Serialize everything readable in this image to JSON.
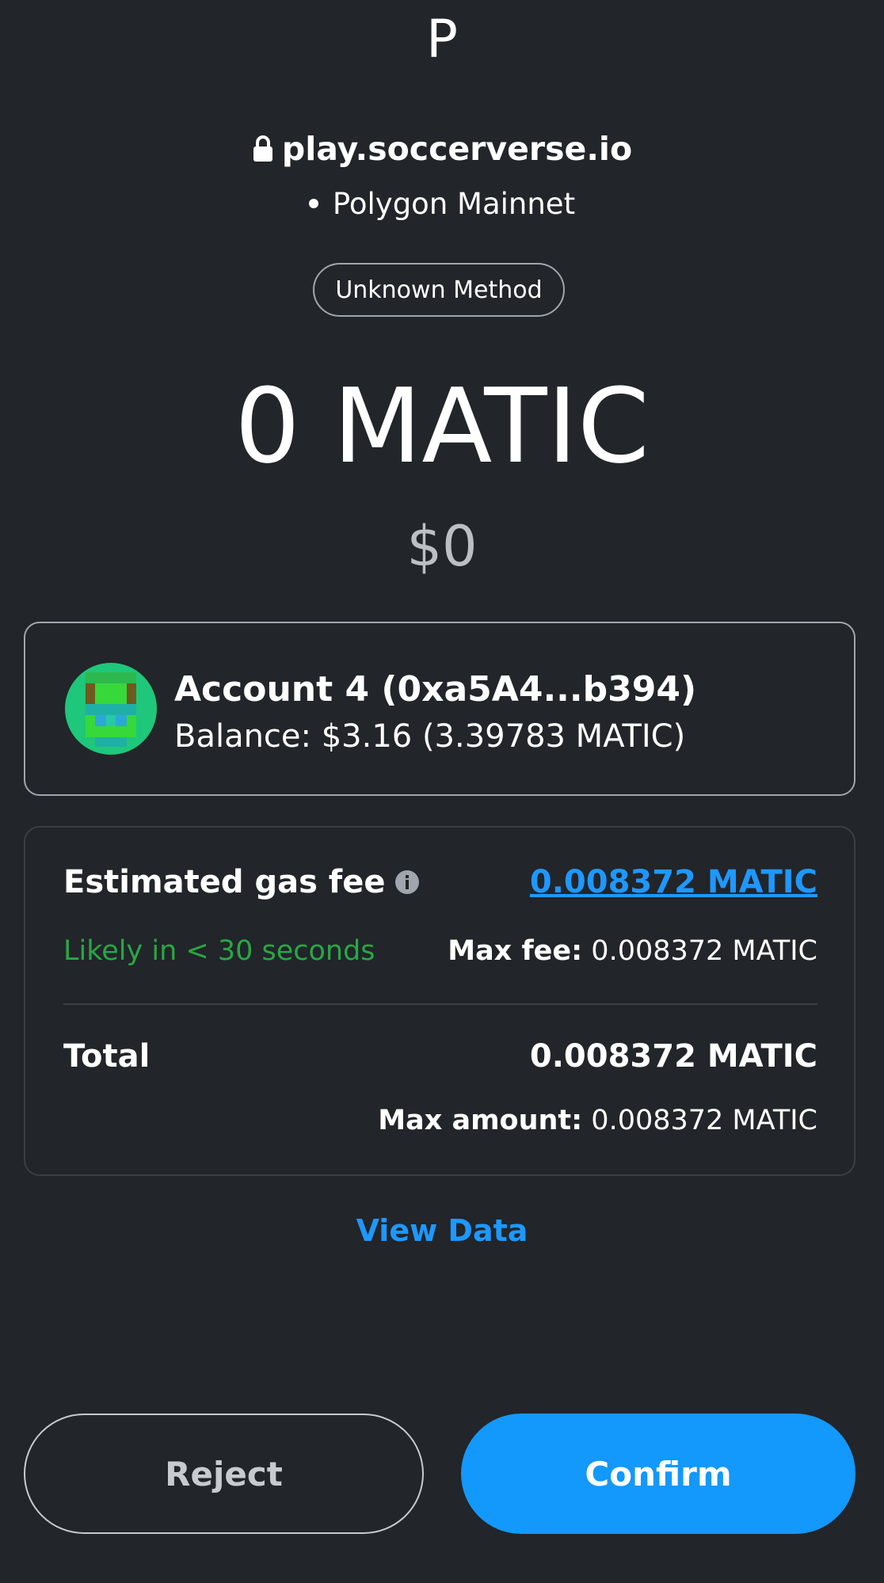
{
  "header": {
    "site_initial": "P",
    "origin": "play.soccerverse.io",
    "network": "Polygon Mainnet",
    "method_label": "Unknown Method"
  },
  "transaction": {
    "amount": "0 MATIC",
    "fiat_amount": "$0"
  },
  "account": {
    "name": "Account 4 (0xa5A4...b394)",
    "balance": "Balance: $3.16 (3.39783 MATIC)"
  },
  "fees": {
    "estimated_label": "Estimated gas fee",
    "estimated_value": "0.008372 MATIC",
    "timing": "Likely in < 30 seconds",
    "max_fee_label": "Max fee:",
    "max_fee_value": "0.008372 MATIC",
    "total_label": "Total",
    "total_value": "0.008372 MATIC",
    "max_amount_label": "Max amount:",
    "max_amount_value": "0.008372 MATIC"
  },
  "links": {
    "view_data": "View Data"
  },
  "actions": {
    "reject_label": "Reject",
    "confirm_label": "Confirm"
  },
  "colors": {
    "background": "#222529",
    "accent": "#1398fb",
    "link": "#1e98ff",
    "success": "#28a745"
  },
  "icons": {
    "origin": "lock-icon",
    "network": "dot-icon",
    "fee_info": "info-icon",
    "account": "identicon-avatar"
  }
}
